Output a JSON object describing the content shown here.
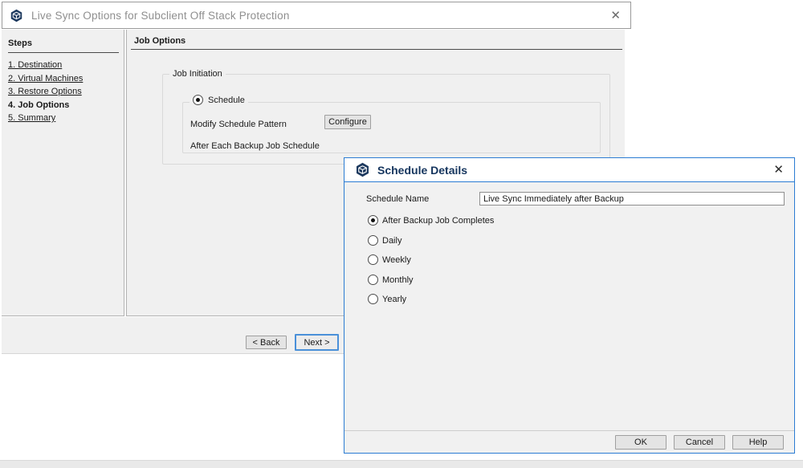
{
  "wizard": {
    "title": "Live Sync Options for Subclient Off Stack Protection",
    "steps_header": "Steps",
    "steps": [
      {
        "label": "1. Destination"
      },
      {
        "label": "2. Virtual Machines"
      },
      {
        "label": "3. Restore Options"
      },
      {
        "label": "4. Job Options"
      },
      {
        "label": "5. Summary"
      }
    ],
    "content_header": "Job Options",
    "job_initiation": {
      "legend": "Job Initiation",
      "schedule_radio_label": "Schedule",
      "modify_label": "Modify Schedule Pattern",
      "configure_button": "Configure",
      "after_each_label": "After Each Backup Job Schedule"
    },
    "back_button": "< Back",
    "next_button": "Next >"
  },
  "dialog": {
    "title": "Schedule Details",
    "schedule_name_label": "Schedule Name",
    "schedule_name_value": "Live Sync Immediately after Backup",
    "options": [
      {
        "label": "After Backup Job Completes",
        "selected": true
      },
      {
        "label": "Daily",
        "selected": false
      },
      {
        "label": "Weekly",
        "selected": false
      },
      {
        "label": "Monthly",
        "selected": false
      },
      {
        "label": "Yearly",
        "selected": false
      }
    ],
    "ok_button": "OK",
    "cancel_button": "Cancel",
    "help_button": "Help"
  },
  "icons": {
    "close_glyph": "✕"
  },
  "colors": {
    "accent_blue": "#2b7cd3",
    "logo_navy": "#1e3a5f",
    "panel_gray": "#f0f0f0",
    "title_gray": "#8f8f8f",
    "dialog_title_navy": "#15355e"
  }
}
